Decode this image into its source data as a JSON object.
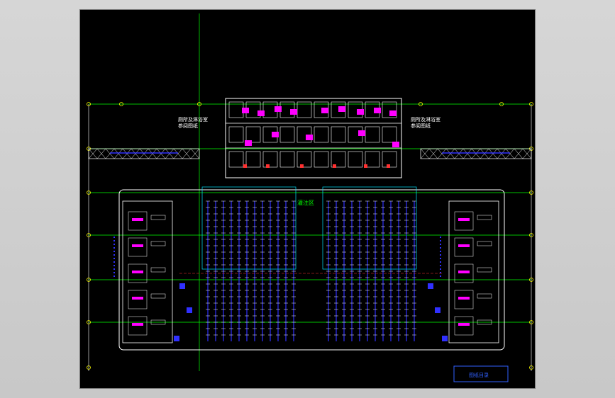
{
  "drawing": {
    "background": "#000000",
    "line_color": "#ffffff",
    "accent_magenta": "#ff00ff",
    "accent_blue": "#3030ff",
    "accent_cyan": "#00e5ff",
    "accent_green": "#00ff00",
    "accent_yellow": "#ffff00",
    "accent_red": "#ff3030",
    "labels": {
      "left_note": "厕所及淋浴室",
      "left_note_2": "参阅图纸",
      "right_note": "厕所及淋浴室",
      "right_note_2": "参阅图纸",
      "center_zone": "灌注区",
      "title_box": "图纸目录"
    }
  }
}
